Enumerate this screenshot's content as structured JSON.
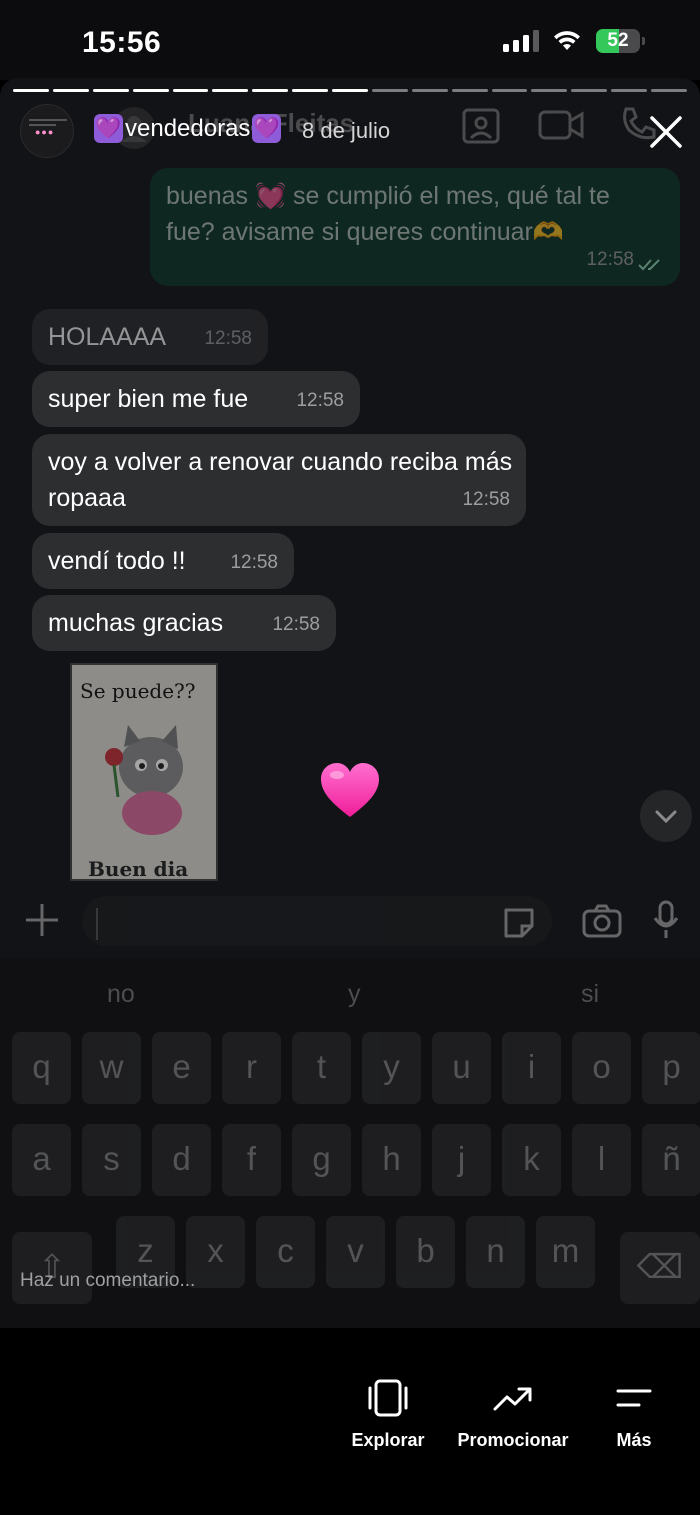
{
  "status_bar": {
    "time": "15:56",
    "battery_text": "52",
    "battery_level": 0.52,
    "battery_color": "#34c759",
    "icons": [
      "cellular-signal-icon",
      "wifi-icon",
      "battery-charging-icon"
    ]
  },
  "story": {
    "segments_total": 17,
    "segments_viewed": 9,
    "user_name": "vendedoras",
    "user_emoji": "💜",
    "date": "8 de julio",
    "close_icon": "close-icon",
    "background_chat_header": "Luana Fleitas"
  },
  "chat": {
    "outgoing": {
      "text": "buenas 💓 se cumplió el mes, qué tal te fue? avisame si queres continuar🫶",
      "time": "12:58"
    },
    "incoming": [
      {
        "text": "HOLAAAA",
        "time": "12:58"
      },
      {
        "text": "super bien me fue",
        "time": "12:58"
      },
      {
        "text": "voy a volver a renovar cuando reciba más ropaaa",
        "time": "12:58"
      },
      {
        "text": "vendí todo !!",
        "time": "12:58"
      },
      {
        "text": "muchas gracias",
        "time": "12:58"
      }
    ],
    "sticker": {
      "top_text": "Se puede??",
      "bottom_text": "Buen dia"
    },
    "reaction_color": "#ff3eb5"
  },
  "keyboard": {
    "suggestions": [
      "no",
      "y",
      "si"
    ],
    "row1": [
      "q",
      "w",
      "e",
      "r",
      "t",
      "y",
      "u",
      "i",
      "o",
      "p"
    ],
    "row2": [
      "a",
      "s",
      "d",
      "f",
      "g",
      "h",
      "j",
      "k",
      "l",
      "ñ"
    ],
    "row3": [
      "z",
      "x",
      "c",
      "v",
      "b",
      "n",
      "m"
    ]
  },
  "comment": {
    "placeholder": "Haz un comentario..."
  },
  "bottom_actions": [
    {
      "label": "Explorar",
      "icon": "explore-icon"
    },
    {
      "label": "Promocionar",
      "icon": "trending-up-icon"
    },
    {
      "label": "Más",
      "icon": "menu-lines-icon"
    }
  ]
}
